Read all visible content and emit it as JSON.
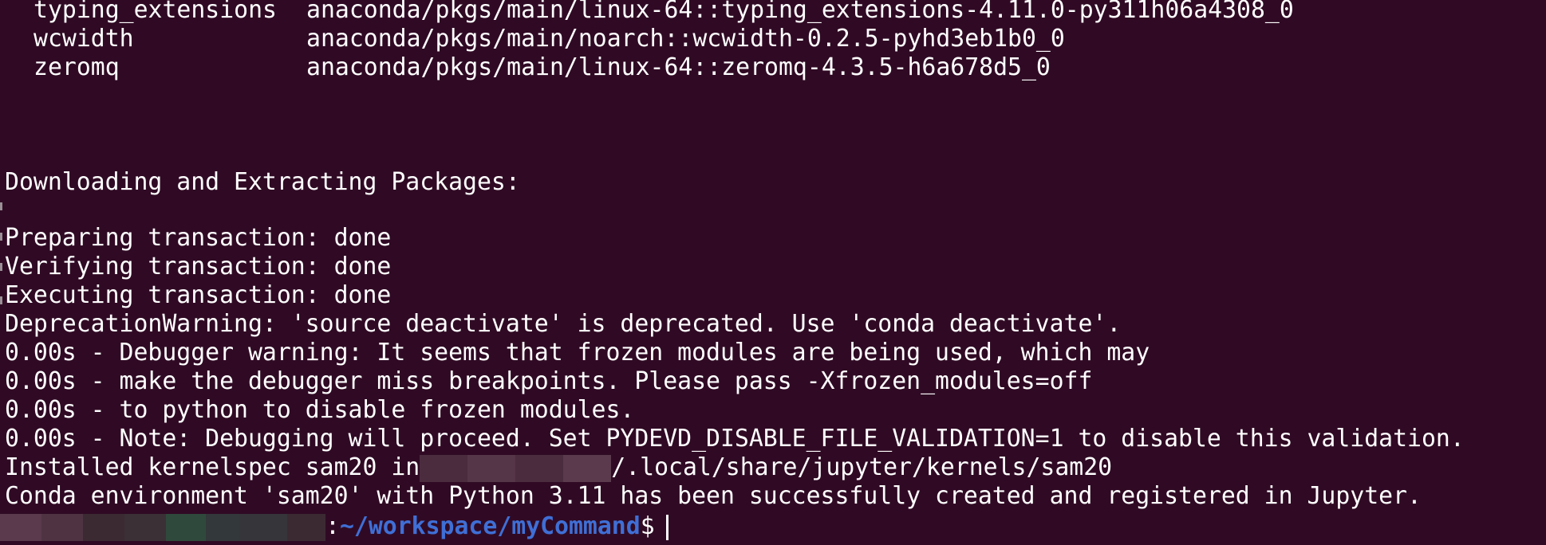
{
  "colors": {
    "background": "#300a24",
    "text": "#ffffff",
    "prompt_path": "#3f6fd6",
    "redaction_user_pale": "#5b3a4d",
    "redaction_user_dark": "#3c2a32",
    "redaction_host_green": "#2f4a3c"
  },
  "packages": [
    {
      "name": "typing_extensions",
      "spec": "anaconda/pkgs/main/linux-64::typing_extensions-4.11.0-py311h06a4308_0"
    },
    {
      "name": "wcwidth",
      "spec": "anaconda/pkgs/main/noarch::wcwidth-0.2.5-pyhd3eb1b0_0"
    },
    {
      "name": "zeromq",
      "spec": "anaconda/pkgs/main/linux-64::zeromq-4.3.5-h6a678d5_0"
    }
  ],
  "output": {
    "downloading": "Downloading and Extracting Packages:",
    "preparing": "Preparing transaction: done",
    "verifying": "Verifying transaction: done",
    "executing": "Executing transaction: done",
    "deprecation": "DeprecationWarning: 'source deactivate' is deprecated. Use 'conda deactivate'.",
    "debug1": "0.00s - Debugger warning: It seems that frozen modules are being used, which may",
    "debug2": "0.00s - make the debugger miss breakpoints. Please pass -Xfrozen_modules=off",
    "debug3": "0.00s - to python to disable frozen modules.",
    "debug4": "0.00s - Note: Debugging will proceed. Set PYDEVD_DISABLE_FILE_VALIDATION=1 to disable this validation.",
    "installed_prefix": "Installed kernelspec sam20 in",
    "installed_suffix": "/.local/share/jupyter/kernels/sam20",
    "success": "Conda environment 'sam20' with Python 3.11 has been successfully created and registered in Jupyter."
  },
  "prompt": {
    "separator": ":",
    "path": "~/workspace/myCommand",
    "symbol": "$"
  }
}
